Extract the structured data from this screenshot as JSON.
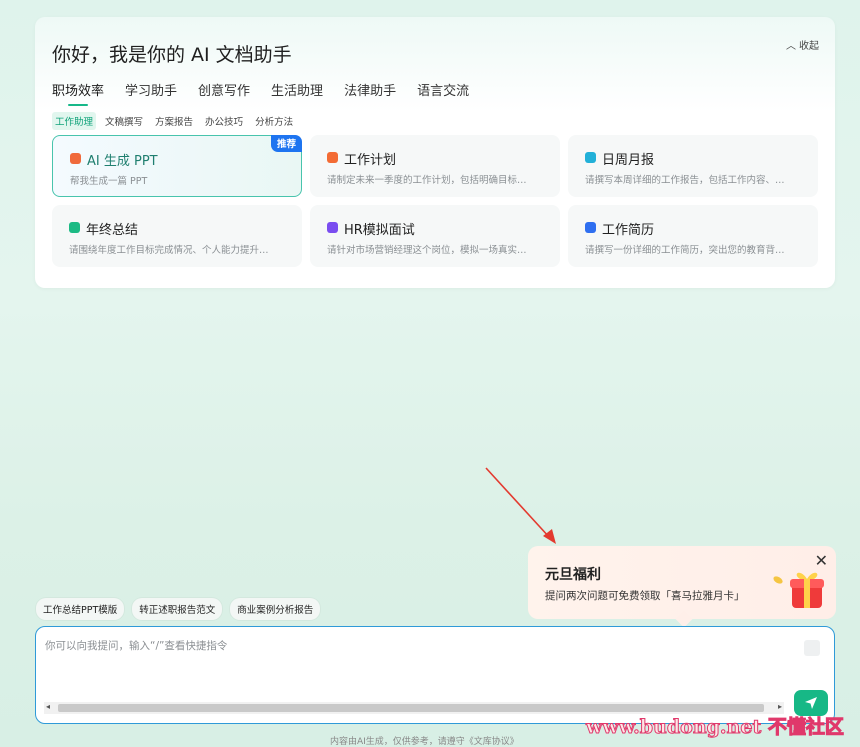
{
  "header": {
    "greeting": "你好，我是你的 AI 文档助手",
    "collapse_label": "收起"
  },
  "tabs": [
    "职场效率",
    "学习助手",
    "创意写作",
    "生活助理",
    "法律助手",
    "语言交流"
  ],
  "subtabs": [
    "工作助理",
    "文稿撰写",
    "方案报告",
    "办公技巧",
    "分析方法"
  ],
  "cards": [
    {
      "title": "AI 生成 PPT",
      "desc": "帮我生成一篇 PPT",
      "badge": "推荐",
      "icon_color": "#f06a3c",
      "icon": "ppt-icon"
    },
    {
      "title": "工作计划",
      "desc": "请制定未来一季度的工作计划，包括明确目标…",
      "icon_color": "#f36b34",
      "icon": "calendar-icon"
    },
    {
      "title": "日周月报",
      "desc": "请撰写本周详细的工作报告，包括工作内容、…",
      "icon_color": "#22b0d8",
      "icon": "report-icon"
    },
    {
      "title": "年终总结",
      "desc": "请围绕年度工作目标完成情况、个人能力提升…",
      "icon_color": "#1cba84",
      "icon": "summary-icon"
    },
    {
      "title": "HR模拟面试",
      "desc": "请针对市场营销经理这个岗位，模拟一场真实…",
      "icon_color": "#7a4df0",
      "icon": "interview-icon"
    },
    {
      "title": "工作简历",
      "desc": "请撰写一份详细的工作简历，突出您的教育背…",
      "icon_color": "#2f6ff0",
      "icon": "resume-icon"
    }
  ],
  "promo": {
    "title": "元旦福利",
    "desc": "提问两次问题可免费领取「喜马拉雅月卡」"
  },
  "chips": [
    "工作总结PPT模版",
    "转正述职报告范文",
    "商业案例分析报告"
  ],
  "input": {
    "placeholder": "你可以向我提问，输入“/”查看快捷指令"
  },
  "footer": "内容由AI生成，仅供参考，请遵守《文库协议》",
  "watermark": "www.budong.net 不懂社区",
  "colors": {
    "accent": "#17b886",
    "input_border": "#2f9ad8",
    "badge": "#1e74f0"
  }
}
